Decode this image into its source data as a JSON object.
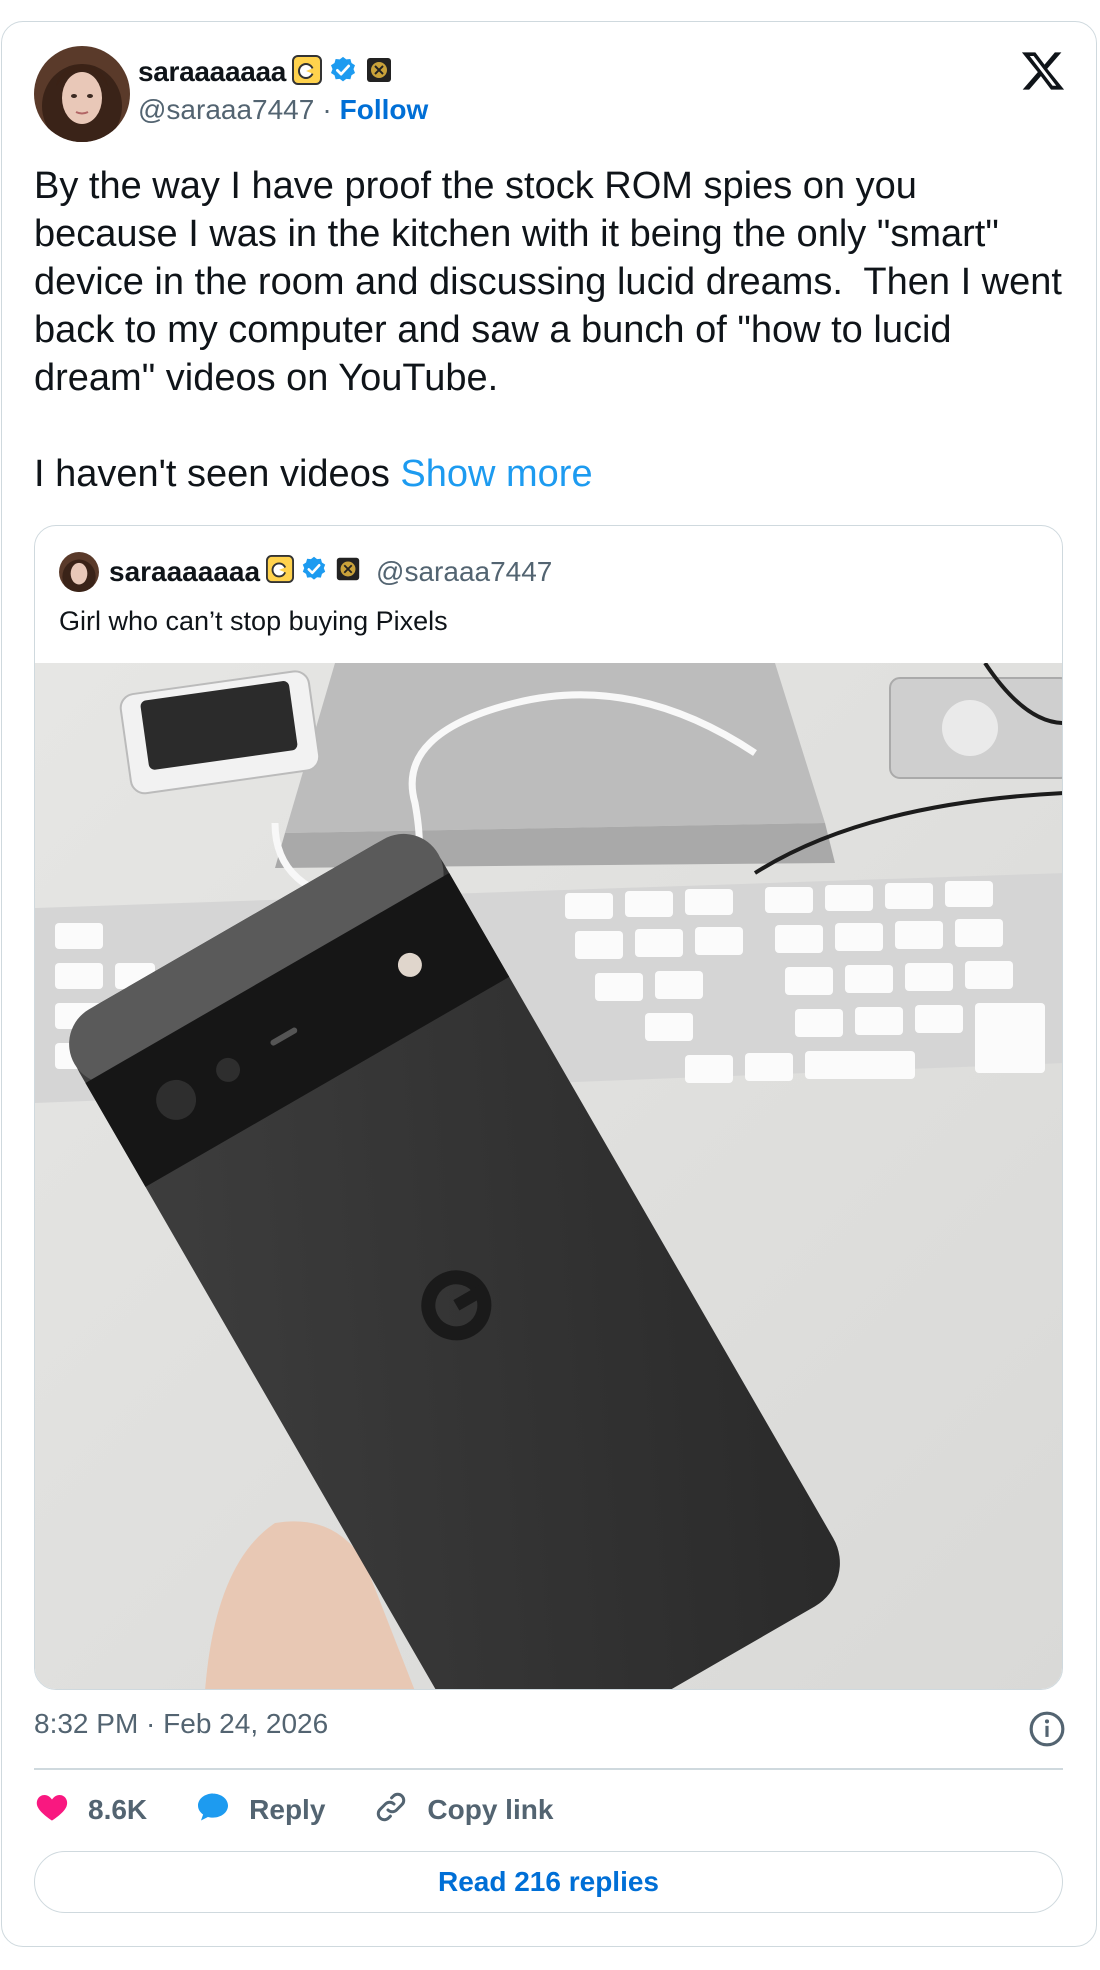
{
  "author": {
    "display_name": "saraaaaaaa",
    "handle": "@saraaa7447",
    "separator": "·",
    "follow_label": "Follow"
  },
  "tweet": {
    "text": "By the way I have proof the stock ROM spies on you because I was in the kitchen with it being the only \"smart\" device in the room and discussing lucid dreams.  Then I went back to my computer and saw a bunch of \"how to lucid dream\" videos on YouTube.\n\nI haven't seen videos ",
    "show_more_label": "Show more"
  },
  "quoted_tweet": {
    "display_name": "saraaaaaaa",
    "handle": "@saraaa7447",
    "text": "Girl who can’t stop buying Pixels"
  },
  "meta": {
    "timestamp": "8:32 PM · Feb 24, 2026"
  },
  "actions": {
    "like_count": "8.6K",
    "reply_label": "Reply",
    "copy_link_label": "Copy link"
  },
  "read_replies_label": "Read 216 replies",
  "icons": {
    "verified": "verified-badge-icon",
    "affiliate": "affiliate-badge-icon",
    "x_logo": "x-logo-icon",
    "info": "info-icon",
    "heart": "heart-icon",
    "reply": "speech-bubble-icon",
    "link": "link-icon"
  },
  "colors": {
    "accent": "#1d9bf0",
    "link": "#006fd6",
    "like": "#f91880",
    "secondary_text": "#536471",
    "border": "#cfd9de"
  }
}
